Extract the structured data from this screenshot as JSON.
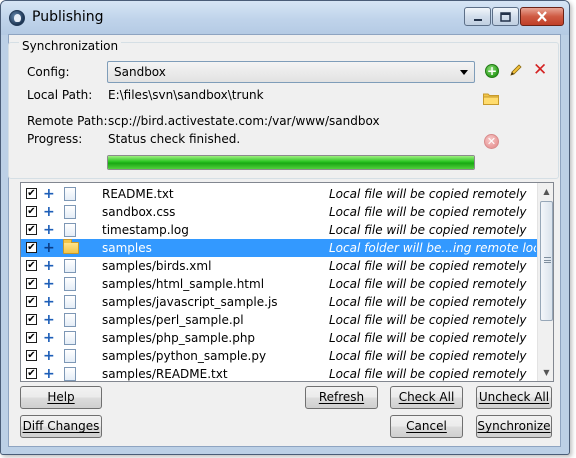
{
  "window": {
    "title": "Publishing"
  },
  "sync": {
    "group_label": "Synchronization",
    "config_label": "Config:",
    "config_value": "Sandbox",
    "local_path_label": "Local Path:",
    "local_path_value": "E:\\files\\svn\\sandbox\\trunk",
    "remote_path_label": "Remote Path:",
    "remote_path_value": "scp://bird.activestate.com:/var/www/sandbox",
    "progress_label": "Progress:",
    "progress_status": "Status check finished.",
    "progress_fraction": 1.0
  },
  "files": [
    {
      "name": "README.txt",
      "status": "Local file will be copied remotely",
      "kind": "file",
      "checked": true,
      "selected": false
    },
    {
      "name": "sandbox.css",
      "status": "Local file will be copied remotely",
      "kind": "file",
      "checked": true,
      "selected": false
    },
    {
      "name": "timestamp.log",
      "status": "Local file will be copied remotely",
      "kind": "file",
      "checked": true,
      "selected": false
    },
    {
      "name": "samples",
      "status": "Local folder will be...ing remote location",
      "kind": "folder",
      "checked": true,
      "selected": true
    },
    {
      "name": "samples/birds.xml",
      "status": "Local file will be copied remotely",
      "kind": "file",
      "checked": true,
      "selected": false
    },
    {
      "name": "samples/html_sample.html",
      "status": "Local file will be copied remotely",
      "kind": "file",
      "checked": true,
      "selected": false
    },
    {
      "name": "samples/javascript_sample.js",
      "status": "Local file will be copied remotely",
      "kind": "file",
      "checked": true,
      "selected": false
    },
    {
      "name": "samples/perl_sample.pl",
      "status": "Local file will be copied remotely",
      "kind": "file",
      "checked": true,
      "selected": false
    },
    {
      "name": "samples/php_sample.php",
      "status": "Local file will be copied remotely",
      "kind": "file",
      "checked": true,
      "selected": false
    },
    {
      "name": "samples/python_sample.py",
      "status": "Local file will be copied remotely",
      "kind": "file",
      "checked": true,
      "selected": false
    },
    {
      "name": "samples/README.txt",
      "status": "Local file will be copied remotely",
      "kind": "file",
      "checked": true,
      "selected": false
    }
  ],
  "buttons": {
    "help": "Help",
    "refresh": "Refresh",
    "check_all": "Check All",
    "uncheck_all": "Uncheck All",
    "diff_changes": "Diff Changes",
    "cancel": "Cancel",
    "synchronize": "Synchronize"
  },
  "icons": {
    "add": "add-config-icon",
    "edit": "edit-pencil-icon",
    "delete": "delete-x-icon",
    "folder": "folder-icon",
    "cancel_sync": "cancel-circle-icon"
  },
  "colors": {
    "selection": "#3399ff",
    "progress": "#27c21f",
    "title_bar": "#bfd3ea"
  }
}
